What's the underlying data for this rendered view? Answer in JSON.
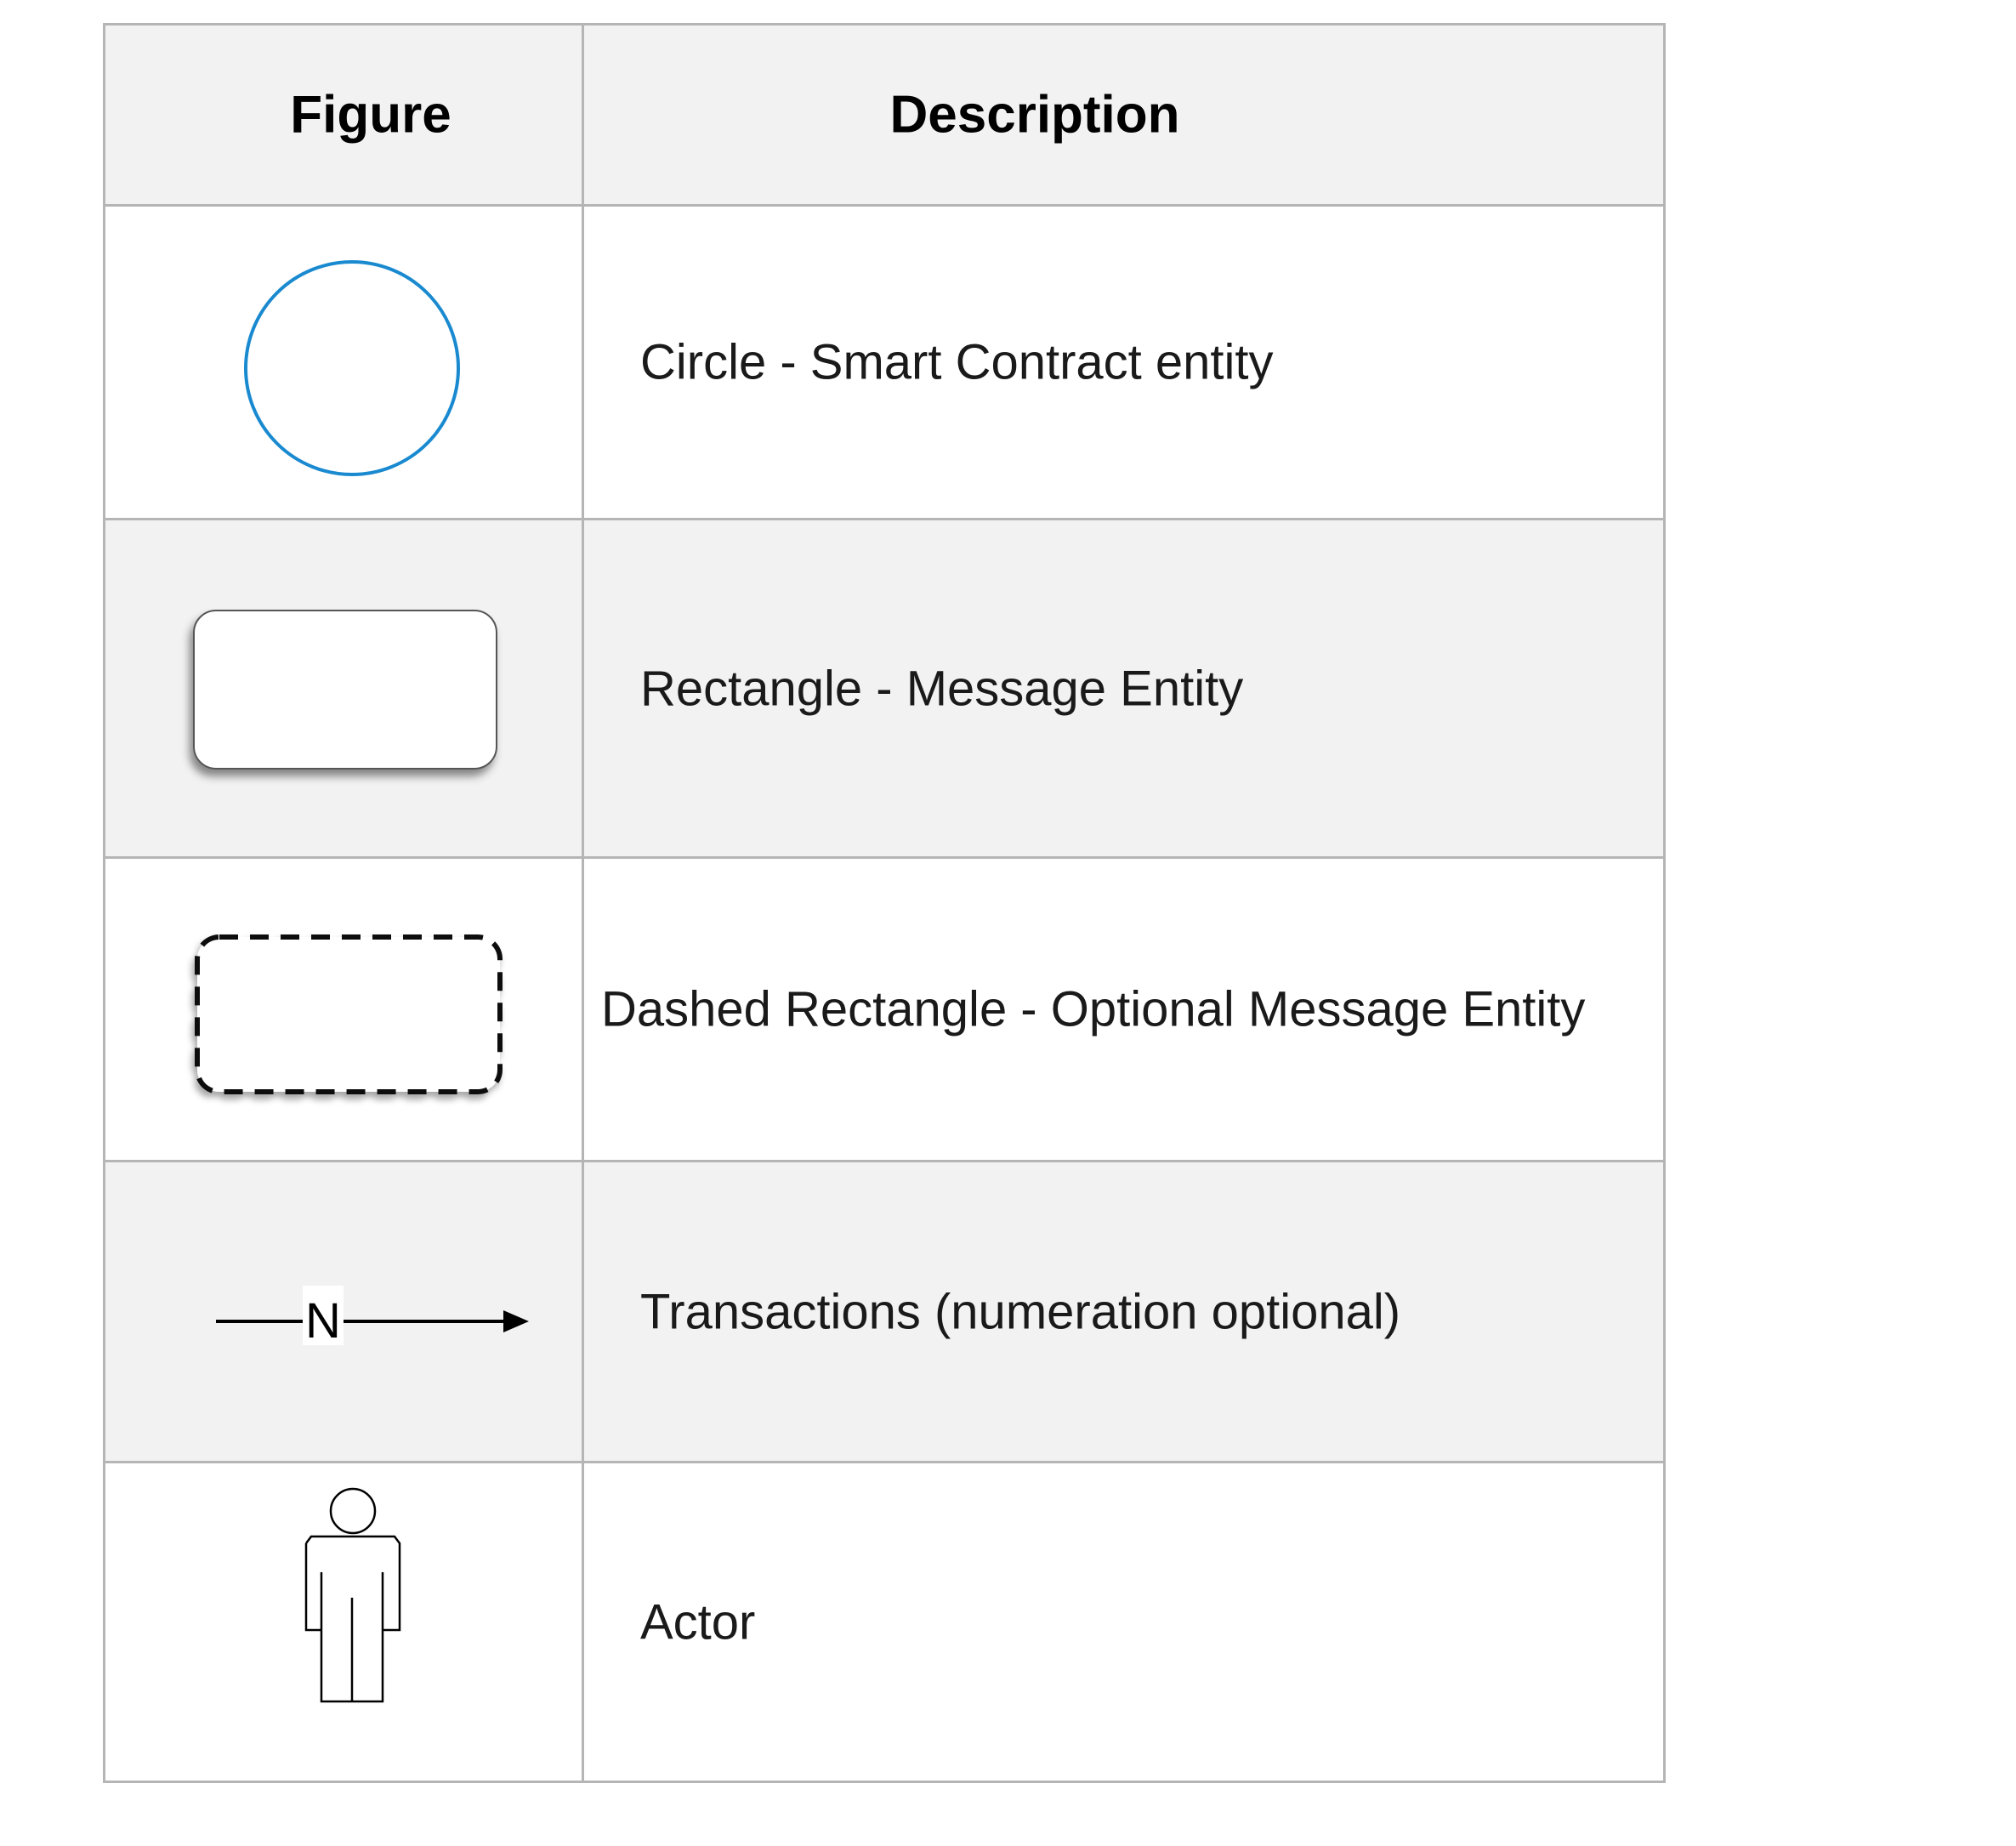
{
  "table": {
    "headers": {
      "figure": "Figure",
      "description": "Description"
    },
    "rows": [
      {
        "figure_icon": "circle-icon",
        "description": "Circle - Smart Contract entity"
      },
      {
        "figure_icon": "rounded-rectangle-icon",
        "description": "Rectangle - Message Entity"
      },
      {
        "figure_icon": "dashed-rectangle-icon",
        "description": "Dashed Rectangle - Optional Message Entity"
      },
      {
        "figure_icon": "arrow-icon",
        "figure_label": "N",
        "description": "Transactions (numeration optional)"
      },
      {
        "figure_icon": "actor-icon",
        "description": "Actor"
      }
    ]
  },
  "colors": {
    "circle_stroke": "#1a8ad0",
    "header_bg": "#f2f2f2",
    "border": "#b5b5b5"
  }
}
